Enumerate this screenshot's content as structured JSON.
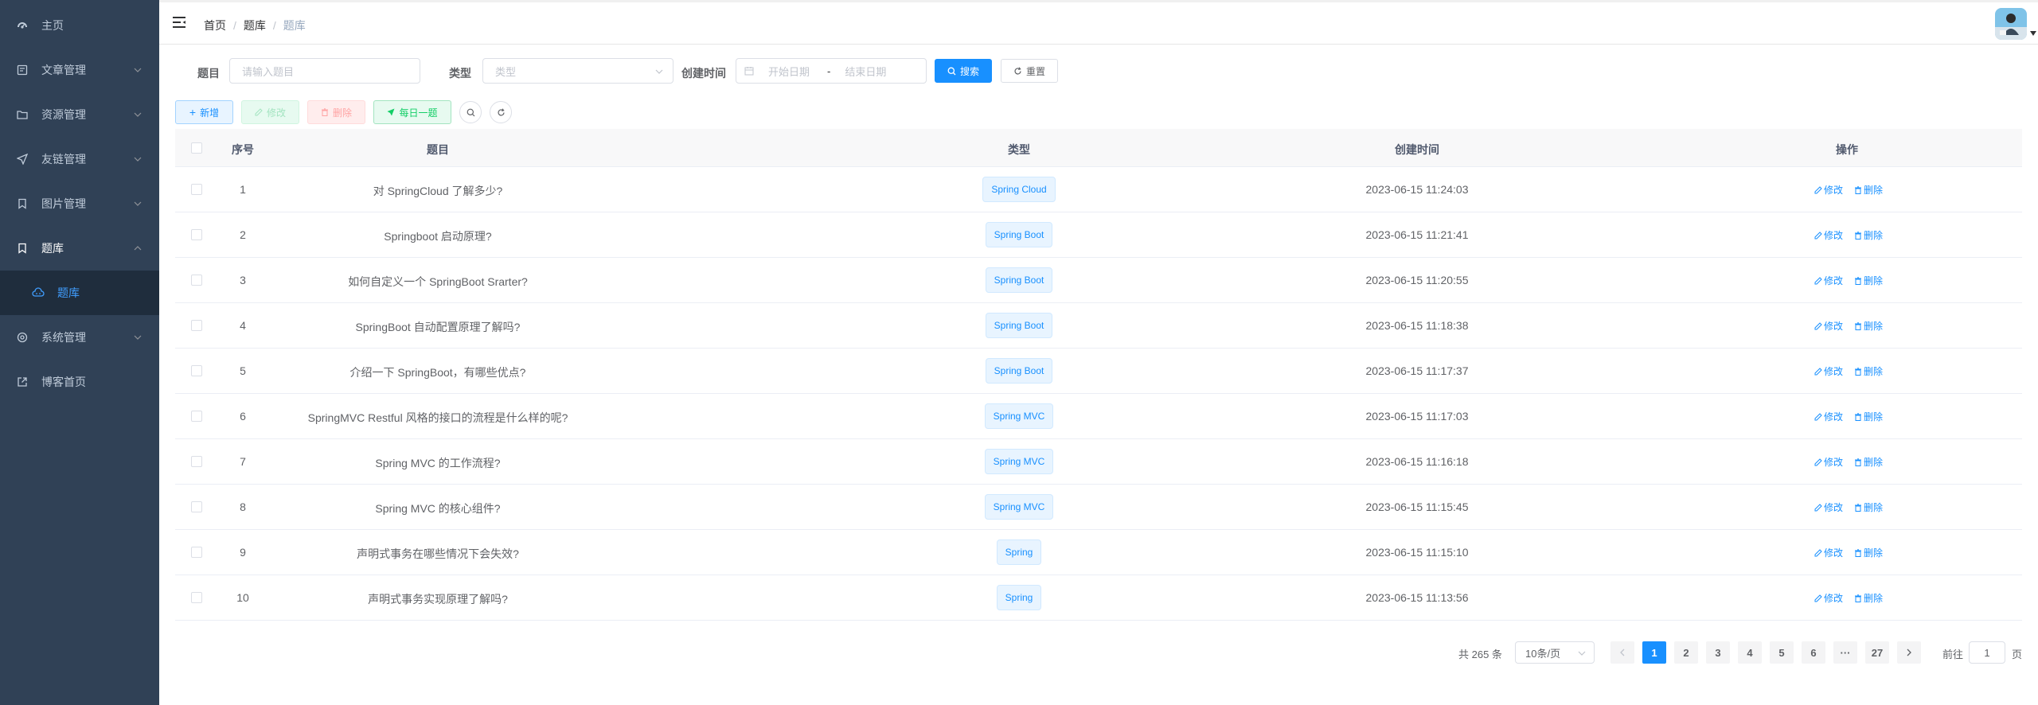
{
  "sidebar": {
    "items": [
      {
        "label": "主页",
        "icon": "dashboard-icon"
      },
      {
        "label": "文章管理",
        "icon": "article-icon"
      },
      {
        "label": "资源管理",
        "icon": "folder-icon"
      },
      {
        "label": "友链管理",
        "icon": "send-icon"
      },
      {
        "label": "图片管理",
        "icon": "bookmark-icon"
      },
      {
        "label": "题库",
        "icon": "bookmark-icon"
      },
      {
        "label": "题库",
        "icon": "cloud-icon"
      },
      {
        "label": "系统管理",
        "icon": "system-icon"
      },
      {
        "label": "博客首页",
        "icon": "external-link-icon"
      }
    ]
  },
  "breadcrumb": [
    "首页",
    "题库",
    "题库"
  ],
  "search": {
    "title_label": "题目",
    "title_placeholder": "请输入题目",
    "type_label": "类型",
    "type_placeholder": "类型",
    "time_label": "创建时间",
    "start_placeholder": "开始日期",
    "range_sep": "-",
    "end_placeholder": "结束日期",
    "search_btn": "搜索",
    "reset_btn": "重置"
  },
  "toolbar": {
    "add": "新增",
    "edit": "修改",
    "delete": "删除",
    "daily": "每日一题"
  },
  "table": {
    "headers": [
      "序号",
      "题目",
      "类型",
      "创建时间",
      "操作"
    ],
    "edit_label": "修改",
    "delete_label": "删除",
    "rows": [
      {
        "no": "1",
        "title": "对 SpringCloud 了解多少?",
        "type": "Spring Cloud",
        "time": "2023-06-15 11:24:03"
      },
      {
        "no": "2",
        "title": "Springboot 启动原理?",
        "type": "Spring Boot",
        "time": "2023-06-15 11:21:41"
      },
      {
        "no": "3",
        "title": "如何自定义一个 SpringBoot Srarter?",
        "type": "Spring Boot",
        "time": "2023-06-15 11:20:55"
      },
      {
        "no": "4",
        "title": "SpringBoot 自动配置原理了解吗?",
        "type": "Spring Boot",
        "time": "2023-06-15 11:18:38"
      },
      {
        "no": "5",
        "title": "介绍一下 SpringBoot，有哪些优点?",
        "type": "Spring Boot",
        "time": "2023-06-15 11:17:37"
      },
      {
        "no": "6",
        "title": "SpringMVC Restful 风格的接口的流程是什么样的呢?",
        "type": "Spring MVC",
        "time": "2023-06-15 11:17:03"
      },
      {
        "no": "7",
        "title": "Spring MVC 的工作流程?",
        "type": "Spring MVC",
        "time": "2023-06-15 11:16:18"
      },
      {
        "no": "8",
        "title": "Spring MVC 的核心组件?",
        "type": "Spring MVC",
        "time": "2023-06-15 11:15:45"
      },
      {
        "no": "9",
        "title": "声明式事务在哪些情况下会失效?",
        "type": "Spring",
        "time": "2023-06-15 11:15:10"
      },
      {
        "no": "10",
        "title": "声明式事务实现原理了解吗?",
        "type": "Spring",
        "time": "2023-06-15 11:13:56"
      }
    ]
  },
  "pagination": {
    "total": "共 265 条",
    "page_size": "10条/页",
    "pages": [
      "1",
      "2",
      "3",
      "4",
      "5",
      "6",
      "···",
      "27"
    ],
    "goto_label": "前往",
    "goto_value": "1",
    "page_suffix": "页"
  }
}
